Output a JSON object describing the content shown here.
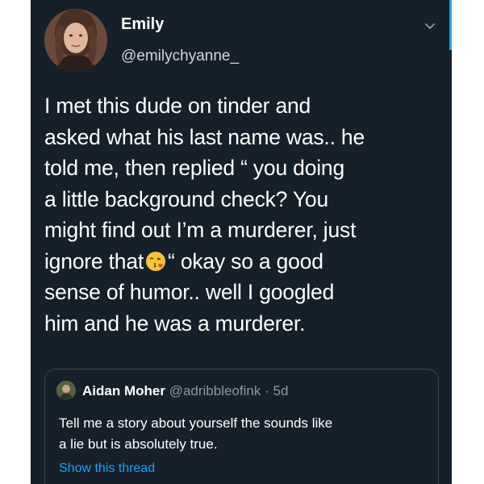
{
  "author": {
    "name": "Emily",
    "handle": "@emilychyanne_"
  },
  "tweet": {
    "lines": [
      "I met this dude on tinder and",
      "asked what his last name was.. he",
      "told me, then replied “ you doing",
      "a little background check? You",
      "might find out I’m a murderer, just"
    ],
    "line6_before": "ignore that",
    "line6_after": "“ okay so a good",
    "lines_end": [
      "sense of humor.. well I googled",
      "him and he was a murderer."
    ],
    "emoji_icon": "face-blowing-kiss-emoji"
  },
  "quoted_tweet": {
    "name": "Aidan Moher",
    "handle": "@adribbleofink",
    "separator": "·",
    "age": "5d",
    "lines": [
      "Tell me a story about yourself the sounds like",
      "a lie but is absolutely true."
    ],
    "show_thread": "Show this thread"
  },
  "colors": {
    "background": "#15202b",
    "text": "#ffffff",
    "secondary_text": "#8899a6",
    "accent": "#1da1f2",
    "border": "#38444d"
  }
}
